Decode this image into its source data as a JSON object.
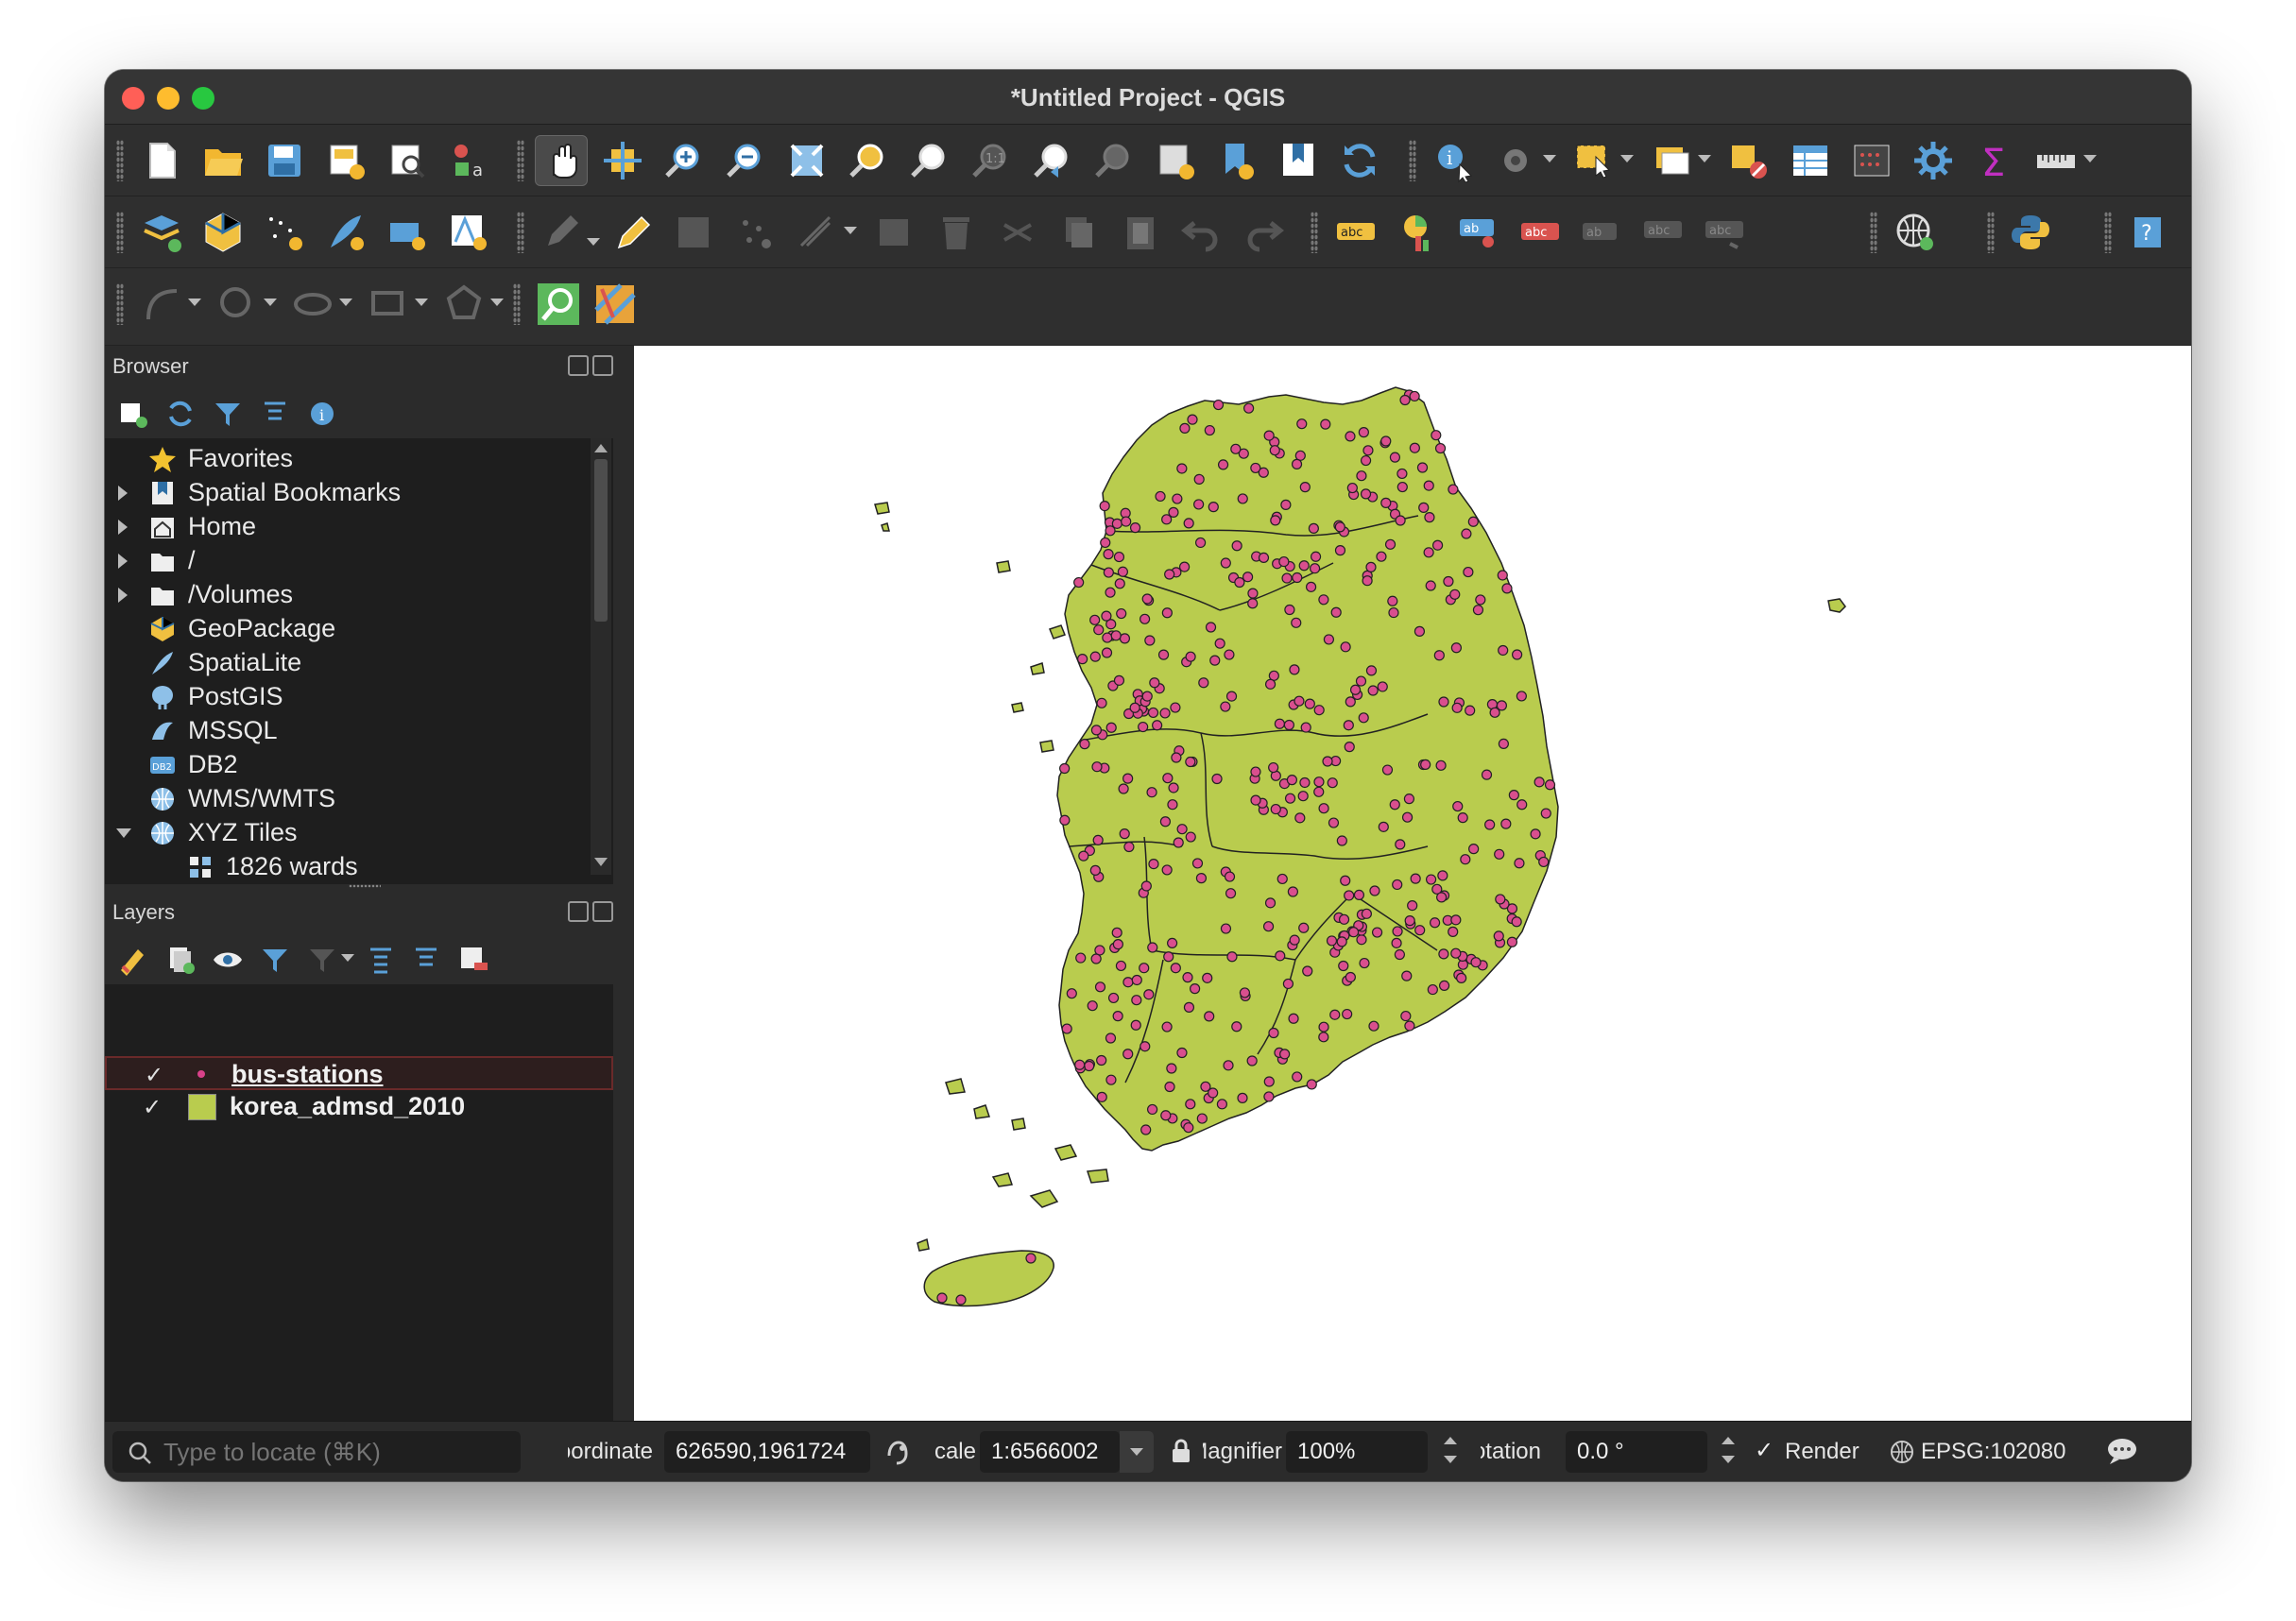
{
  "window": {
    "title": "*Untitled Project - QGIS"
  },
  "browser": {
    "title": "Browser",
    "items": [
      {
        "label": "Favorites",
        "icon": "star-icon",
        "expander": "none"
      },
      {
        "label": "Spatial Bookmarks",
        "icon": "bookmark-icon",
        "expander": "collapsed"
      },
      {
        "label": "Home",
        "icon": "home-icon",
        "expander": "collapsed"
      },
      {
        "label": "/",
        "icon": "folder-icon",
        "expander": "collapsed"
      },
      {
        "label": "/Volumes",
        "icon": "folder-icon",
        "expander": "collapsed"
      },
      {
        "label": "GeoPackage",
        "icon": "geopackage-icon",
        "expander": "none"
      },
      {
        "label": "SpatiaLite",
        "icon": "spatialite-icon",
        "expander": "none"
      },
      {
        "label": "PostGIS",
        "icon": "postgis-icon",
        "expander": "none"
      },
      {
        "label": "MSSQL",
        "icon": "mssql-icon",
        "expander": "none"
      },
      {
        "label": "DB2",
        "icon": "db2-icon",
        "expander": "none"
      },
      {
        "label": "WMS/WMTS",
        "icon": "globe-icon",
        "expander": "none"
      },
      {
        "label": "XYZ Tiles",
        "icon": "globe-icon",
        "expander": "expanded"
      },
      {
        "label": "1826 wards",
        "icon": "tiles-icon",
        "expander": "child"
      }
    ],
    "db2_badge": "DB2"
  },
  "layers": {
    "title": "Layers",
    "items": [
      {
        "name": "bus-stations",
        "checked": true,
        "symbol_color": "#d9418a",
        "selected": true
      },
      {
        "name": "korea_admsd_2010",
        "checked": true,
        "symbol_color": "#b9cc4e",
        "selected": false
      }
    ],
    "check_mark": "✓"
  },
  "map": {
    "land_color": "#b9cc4e",
    "point_color": "#d94f8e",
    "background": "#ffffff"
  },
  "status": {
    "locate_placeholder": "Type to locate (⌘K)",
    "coordinate_label": "Coordinate",
    "coordinate_value": "626590,1961724",
    "scale_label": "Scale",
    "scale_value": "1:6566002",
    "magnifier_label": "Magnifier",
    "magnifier_value": "100%",
    "rotation_label": "Rotation",
    "rotation_value": "0.0 °",
    "render_label": "Render",
    "render_checked": "✓",
    "crs_label": "EPSG:102080"
  }
}
